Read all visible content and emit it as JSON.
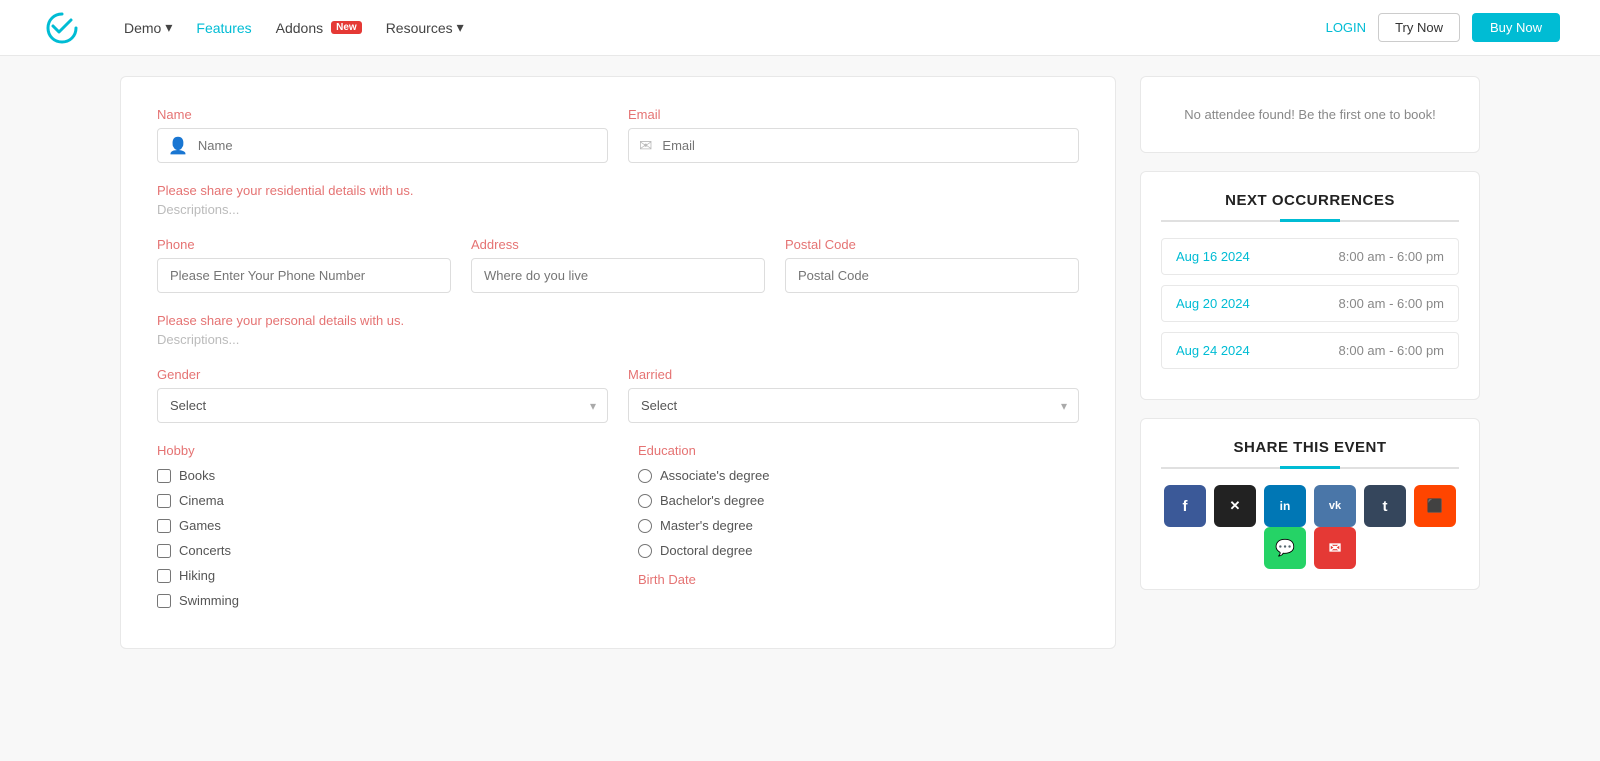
{
  "navbar": {
    "logo_alt": "Mage Events Logo",
    "nav_items": [
      {
        "label": "Demo",
        "dropdown": true,
        "active": false
      },
      {
        "label": "Features",
        "dropdown": false,
        "active": true
      },
      {
        "label": "Addons",
        "dropdown": false,
        "active": false,
        "badge": "New"
      },
      {
        "label": "Resources",
        "dropdown": true,
        "active": false
      }
    ],
    "login_label": "LOGIN",
    "try_label": "Try Now",
    "buy_label": "Buy Now"
  },
  "form": {
    "name_label": "Name",
    "name_placeholder": "Name",
    "email_label": "Email",
    "email_placeholder": "Email",
    "residential_notice": "Please share your residential details with us.",
    "residential_desc": "Descriptions...",
    "phone_label": "Phone",
    "phone_placeholder": "Please Enter Your Phone Number",
    "address_label": "Address",
    "address_placeholder": "Where do you live",
    "postal_label": "Postal Code",
    "postal_placeholder": "Postal Code",
    "personal_notice": "Please share your personal details with us.",
    "personal_desc": "Descriptions...",
    "gender_label": "Gender",
    "gender_placeholder": "Select",
    "married_label": "Married",
    "married_placeholder": "Select",
    "hobby_label": "Hobby",
    "hobbies": [
      {
        "label": "Books"
      },
      {
        "label": "Cinema"
      },
      {
        "label": "Games"
      },
      {
        "label": "Concerts"
      },
      {
        "label": "Hiking"
      },
      {
        "label": "Swimming"
      }
    ],
    "education_label": "Education",
    "education_options": [
      {
        "label": "Associate's degree"
      },
      {
        "label": "Bachelor's degree"
      },
      {
        "label": "Master's degree"
      },
      {
        "label": "Doctoral degree"
      }
    ],
    "birth_date_label": "Birth Date"
  },
  "sidebar": {
    "no_attendee_text": "No attendee found! Be the first one to book!",
    "next_occurrences_title": "NEXT OCCURRENCES",
    "occurrences": [
      {
        "date": "Aug 16 2024",
        "time": "8:00 am - 6:00 pm"
      },
      {
        "date": "Aug 20 2024",
        "time": "8:00 am - 6:00 pm"
      },
      {
        "date": "Aug 24 2024",
        "time": "8:00 am - 6:00 pm"
      }
    ],
    "share_title": "SHARE THIS EVENT",
    "share_buttons": [
      {
        "platform": "facebook",
        "label": "f"
      },
      {
        "platform": "twitter",
        "label": "✕"
      },
      {
        "platform": "linkedin",
        "label": "in"
      },
      {
        "platform": "vk",
        "label": "vk"
      },
      {
        "platform": "tumblr",
        "label": "t"
      },
      {
        "platform": "reddit",
        "label": "🔥"
      },
      {
        "platform": "whatsapp",
        "label": "💬"
      },
      {
        "platform": "email-share",
        "label": "✉"
      }
    ]
  }
}
